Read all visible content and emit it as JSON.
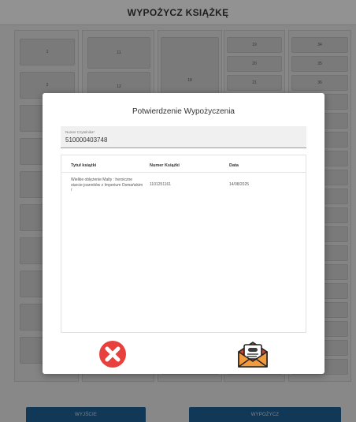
{
  "header": {
    "title": "WYPOŻYCZ KSIĄŻKĘ"
  },
  "grid": {
    "visible_numbers": [
      "1",
      "2",
      "11",
      "12",
      "18",
      "19",
      "20",
      "21",
      "34",
      "35",
      "36"
    ]
  },
  "modal": {
    "title": "Potwierdzenie Wypożyczenia",
    "reader_label": "Numer Czytelnika*",
    "reader_value": "510000403748",
    "columns": {
      "title": "Tytuł książki",
      "number": "Numer Książki",
      "date": "Data"
    },
    "rows": [
      {
        "title": "Wielkie oblężenie Malty : heroiczne starcie joannitów z Imperium Osmańskim /",
        "number": "1101251161",
        "date": "14/08/2025"
      }
    ],
    "cancel_icon": "close-x-icon",
    "confirm_icon": "envelope-letter-icon"
  },
  "footer": {
    "exit_label": "WYJŚCIE",
    "borrow_label": "WYPOŻYCZ"
  },
  "colors": {
    "accent": "#1d5b8f",
    "cancel": "#e8403d",
    "envelope": "#f19a3e"
  }
}
